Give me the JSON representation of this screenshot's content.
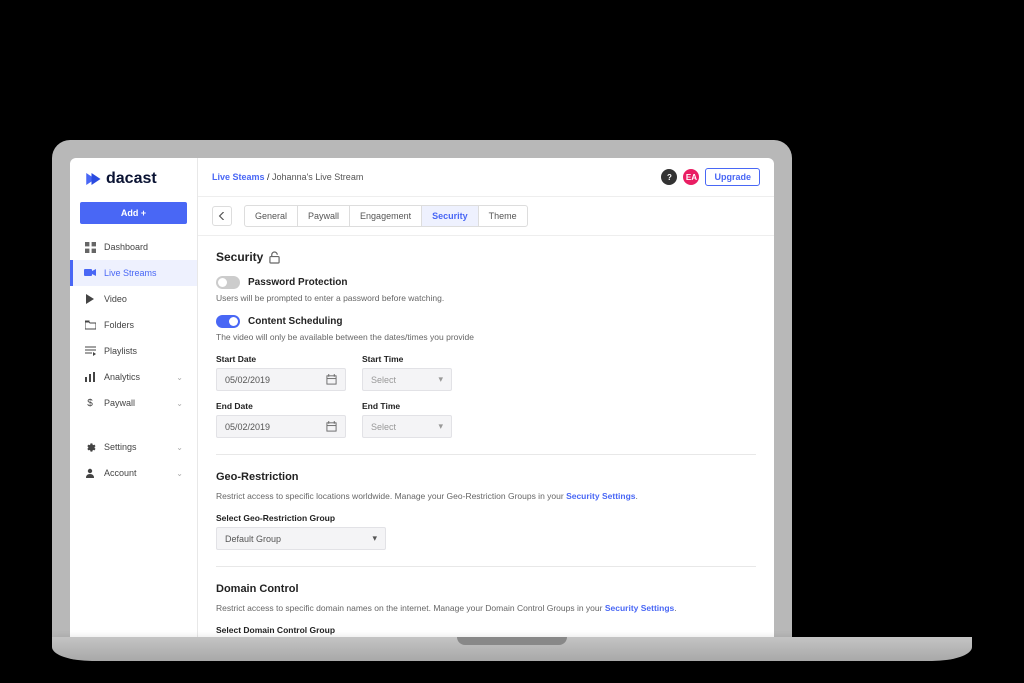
{
  "brand": "dacast",
  "add_button": "Add +",
  "nav": {
    "dashboard": "Dashboard",
    "live_streams": "Live Streams",
    "video": "Video",
    "folders": "Folders",
    "playlists": "Playlists",
    "analytics": "Analytics",
    "paywall": "Paywall",
    "settings": "Settings",
    "account": "Account"
  },
  "breadcrumb": {
    "parent": "Live Steams",
    "sep": " / ",
    "current": "Johanna's Live Stream"
  },
  "topbar": {
    "avatar_initials": "EA",
    "upgrade": "Upgrade",
    "help": "?"
  },
  "tabs": {
    "general": "General",
    "paywall": "Paywall",
    "engagement": "Engagement",
    "security": "Security",
    "theme": "Theme"
  },
  "security": {
    "heading": "Security",
    "password_protection": {
      "label": "Password Protection",
      "desc": "Users will be prompted to enter a password before watching."
    },
    "content_scheduling": {
      "label": "Content Scheduling",
      "desc": "The video will only be available between the dates/times you provide"
    },
    "start_date_label": "Start Date",
    "start_time_label": "Start Time",
    "end_date_label": "End Date",
    "end_time_label": "End Time",
    "start_date_value": "05/02/2019",
    "end_date_value": "05/02/2019",
    "select_placeholder": "Select"
  },
  "geo": {
    "heading": "Geo-Restriction",
    "desc_pre": "Restrict access to specific locations worldwide. Manage your Geo-Restriction Groups in your ",
    "link": "Security Settings",
    "desc_post": ".",
    "select_label": "Select Geo-Restriction Group",
    "select_value": "Default Group"
  },
  "domain": {
    "heading": "Domain Control",
    "desc_pre": "Restrict access to specific domain names on the internet. Manage your Domain Control Groups in your ",
    "link": "Security Settings",
    "desc_post": ".",
    "select_label": "Select Domain Control Group"
  }
}
